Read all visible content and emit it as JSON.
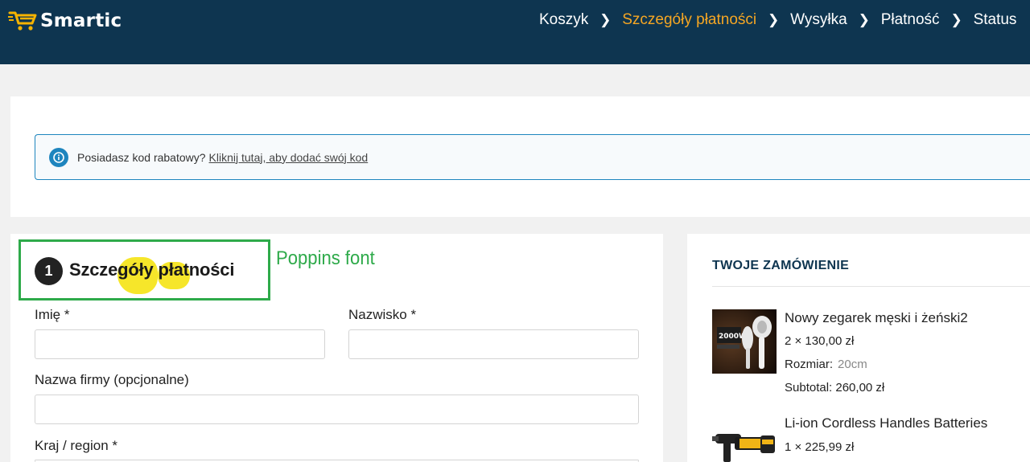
{
  "header": {
    "brand": "Smartic",
    "steps": [
      "Koszyk",
      "Szczegóły płatności",
      "Wysyłka",
      "Płatność",
      "Status"
    ],
    "active_step": "Szczegóły płatności",
    "colors": {
      "background": "#0e3550",
      "active": "#f5a623"
    }
  },
  "coupon": {
    "text": "Posiadasz kod rabatowy?",
    "link": "Kliknij tutaj, aby dodać swój kod"
  },
  "billing": {
    "step_number": "1",
    "title": "Szczegóły płatności",
    "annotation": "Poppins font",
    "fields": {
      "first_name": {
        "label": "Imię *",
        "value": ""
      },
      "last_name": {
        "label": "Nazwisko *",
        "value": ""
      },
      "company": {
        "label": "Nazwa firmy (opcjonalne)",
        "value": ""
      },
      "country": {
        "label": "Kraj / region *",
        "value": ""
      }
    }
  },
  "order": {
    "title": "TWOJE ZAMÓWIENIE",
    "items": [
      {
        "name": "Nowy zegarek męski i żeński2",
        "qty_price": "2 × 130,00 zł",
        "meta_label": "Rozmiar:",
        "meta_value": "20cm",
        "subtotal": "Subtotal: 260,00 zł",
        "thumb_text": "2000W",
        "thumb_icon": "hair-dryer-image"
      },
      {
        "name": "Li-ion Cordless Handles Batteries",
        "qty_price": "1 × 225,99 zł",
        "thumb_icon": "cordless-drill-image"
      }
    ]
  }
}
